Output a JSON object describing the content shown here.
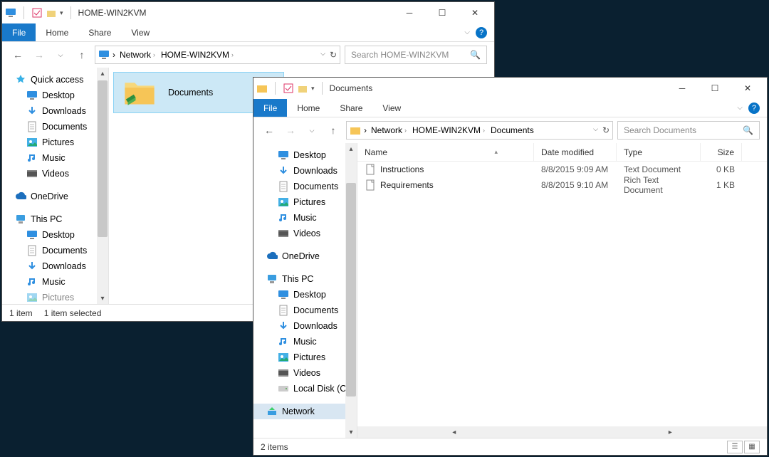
{
  "win1": {
    "title": "HOME-WIN2KVM",
    "tabs": {
      "file": "File",
      "home": "Home",
      "share": "Share",
      "view": "View"
    },
    "breadcrumb": [
      "Network",
      "HOME-WIN2KVM"
    ],
    "search_placeholder": "Search HOME-WIN2KVM",
    "nav": {
      "quick": "Quick access",
      "desktop": "Desktop",
      "downloads": "Downloads",
      "documents": "Documents",
      "pictures": "Pictures",
      "music": "Music",
      "videos": "Videos",
      "onedrive": "OneDrive",
      "thispc": "This PC"
    },
    "folder": "Documents",
    "status_items": "1 item",
    "status_sel": "1 item selected"
  },
  "win2": {
    "title": "Documents",
    "tabs": {
      "file": "File",
      "home": "Home",
      "share": "Share",
      "view": "View"
    },
    "breadcrumb": [
      "Network",
      "HOME-WIN2KVM",
      "Documents"
    ],
    "search_placeholder": "Search Documents",
    "nav": {
      "desktop": "Desktop",
      "downloads": "Downloads",
      "documents": "Documents",
      "pictures": "Pictures",
      "music": "Music",
      "videos": "Videos",
      "onedrive": "OneDrive",
      "thispc": "This PC",
      "localdisk": "Local Disk (C:)",
      "network": "Network"
    },
    "columns": {
      "name": "Name",
      "date": "Date modified",
      "type": "Type",
      "size": "Size"
    },
    "files": [
      {
        "name": "Instructions",
        "date": "8/8/2015 9:09 AM",
        "type": "Text Document",
        "size": "0 KB"
      },
      {
        "name": "Requirements",
        "date": "8/8/2015 9:10 AM",
        "type": "Rich Text Document",
        "size": "1 KB"
      }
    ],
    "status_items": "2 items"
  }
}
